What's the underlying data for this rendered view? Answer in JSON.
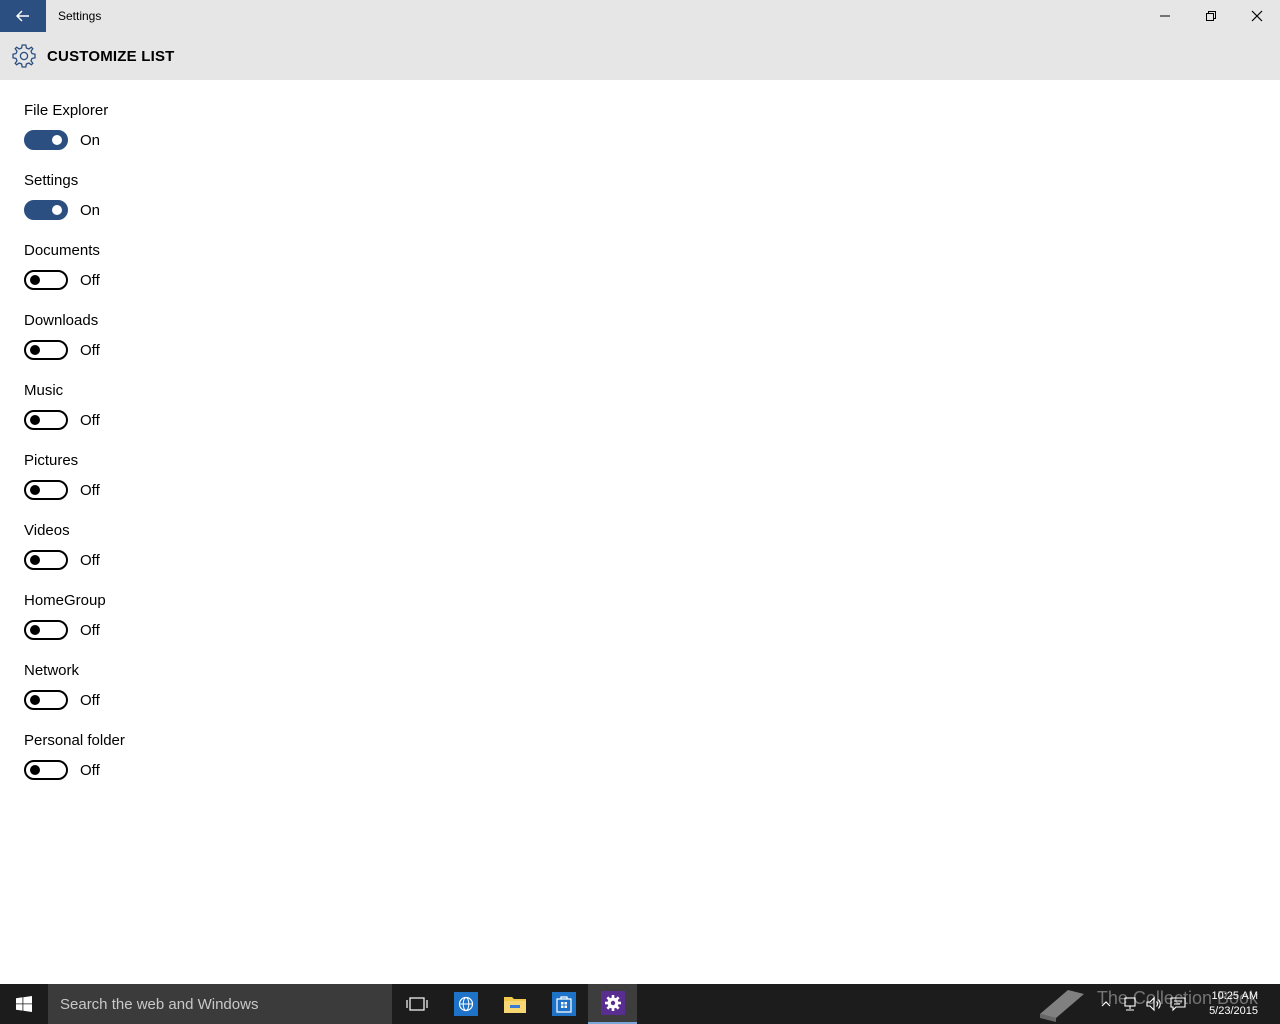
{
  "window": {
    "title": "Settings",
    "accent": "#2b4f80"
  },
  "header": {
    "title": "CUSTOMIZE LIST",
    "icon": "gear-icon"
  },
  "items": [
    {
      "label": "File Explorer",
      "state": "On",
      "on": true
    },
    {
      "label": "Settings",
      "state": "On",
      "on": true
    },
    {
      "label": "Documents",
      "state": "Off",
      "on": false
    },
    {
      "label": "Downloads",
      "state": "Off",
      "on": false
    },
    {
      "label": "Music",
      "state": "Off",
      "on": false
    },
    {
      "label": "Pictures",
      "state": "Off",
      "on": false
    },
    {
      "label": "Videos",
      "state": "Off",
      "on": false
    },
    {
      "label": "HomeGroup",
      "state": "Off",
      "on": false
    },
    {
      "label": "Network",
      "state": "Off",
      "on": false
    },
    {
      "label": "Personal folder",
      "state": "Off",
      "on": false
    }
  ],
  "taskbar": {
    "search_placeholder": "Search the web and Windows",
    "time": "10:25 AM",
    "date": "5/23/2015",
    "watermark": "The Collection Book"
  }
}
